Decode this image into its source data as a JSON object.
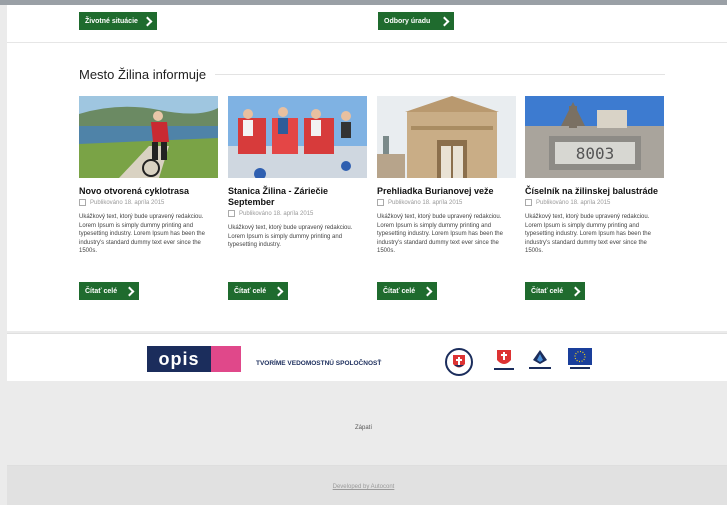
{
  "top_buttons": {
    "life_situations": "Životné situácie",
    "departments": "Odbory úradu"
  },
  "news": {
    "title": "Mesto Žilina informuje",
    "read_more_label": "Čítať celé",
    "items": [
      {
        "title": "Novo otvorená cyklotrasa",
        "date": "Publikováno 18. apríla 2015",
        "text": "Ukážkový text, ktorý bude upravený redakciou. Lorem Ipsum is simply dummy printing and typesetting industry. Lorem Ipsum has been the industry's standard dummy text ever since the 1500s.",
        "image_icon": "cyclist-photo"
      },
      {
        "title": "Stanica Žilina - Záriečie September",
        "date": "Publikováno 18. apríla 2015",
        "text": "Ukážkový text, ktorý bude upravený redakciou. Lorem Ipsum is simply dummy printing and typesetting industry.",
        "image_icon": "people-sculpture-photo"
      },
      {
        "title": "Prehliadka Burianovej veže",
        "date": "Publikováno 18. apríla 2015",
        "text": "Ukážkový text, ktorý bude upravený redakciou. Lorem Ipsum is simply dummy printing and typesetting industry. Lorem Ipsum has been the industry's standard dummy text ever since the 1500s.",
        "image_icon": "tower-photo"
      },
      {
        "title": "Číselník na žilinskej balustráde",
        "date": "Publikováno 18. apríla 2015",
        "text": "Ukážkový text, ktorý bude upravený redakciou. Lorem Ipsum is simply dummy printing and typesetting industry. Lorem Ipsum has been the industry's standard dummy text ever since the 1500s.",
        "image_icon": "number-display-photo",
        "sign_text": "8003"
      }
    ]
  },
  "partners": {
    "opis_logo": "opis",
    "tagline": "TVORÍME VEDOMOSTNÚ SPOLOČNOSŤ"
  },
  "footer": {
    "text": "Zápatí",
    "developed_by": "Developed by Autocont"
  },
  "colors": {
    "accent_green": "#1f6b2e",
    "opis_blue": "#1b2d5c",
    "opis_pink": "#e0488a",
    "eu_blue": "#1a3f9b"
  }
}
